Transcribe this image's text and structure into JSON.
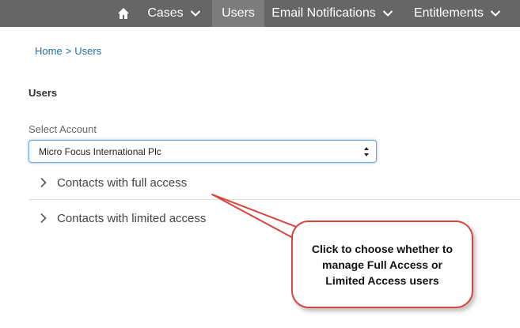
{
  "nav": {
    "home_icon": "home-icon",
    "items": [
      {
        "label": "Cases",
        "has_dropdown": true
      },
      {
        "label": "Users",
        "has_dropdown": false,
        "active": true
      },
      {
        "label": "Email Notifications",
        "has_dropdown": true
      },
      {
        "label": "Entitlements",
        "has_dropdown": true
      }
    ],
    "bar_color": "#666666",
    "active_color": "#7d7d7d"
  },
  "breadcrumb": {
    "home": "Home",
    "separator": ">",
    "current": "Users"
  },
  "page": {
    "title": "Users",
    "select_label": "Select Account",
    "selected_account": "Micro Focus International Plc"
  },
  "accordion": [
    {
      "label": "Contacts with full access"
    },
    {
      "label": "Contacts with limited access"
    }
  ],
  "callout": {
    "text": "Click to choose whether to manage Full Access or Limited Access users",
    "border_color": "#d9443b"
  }
}
